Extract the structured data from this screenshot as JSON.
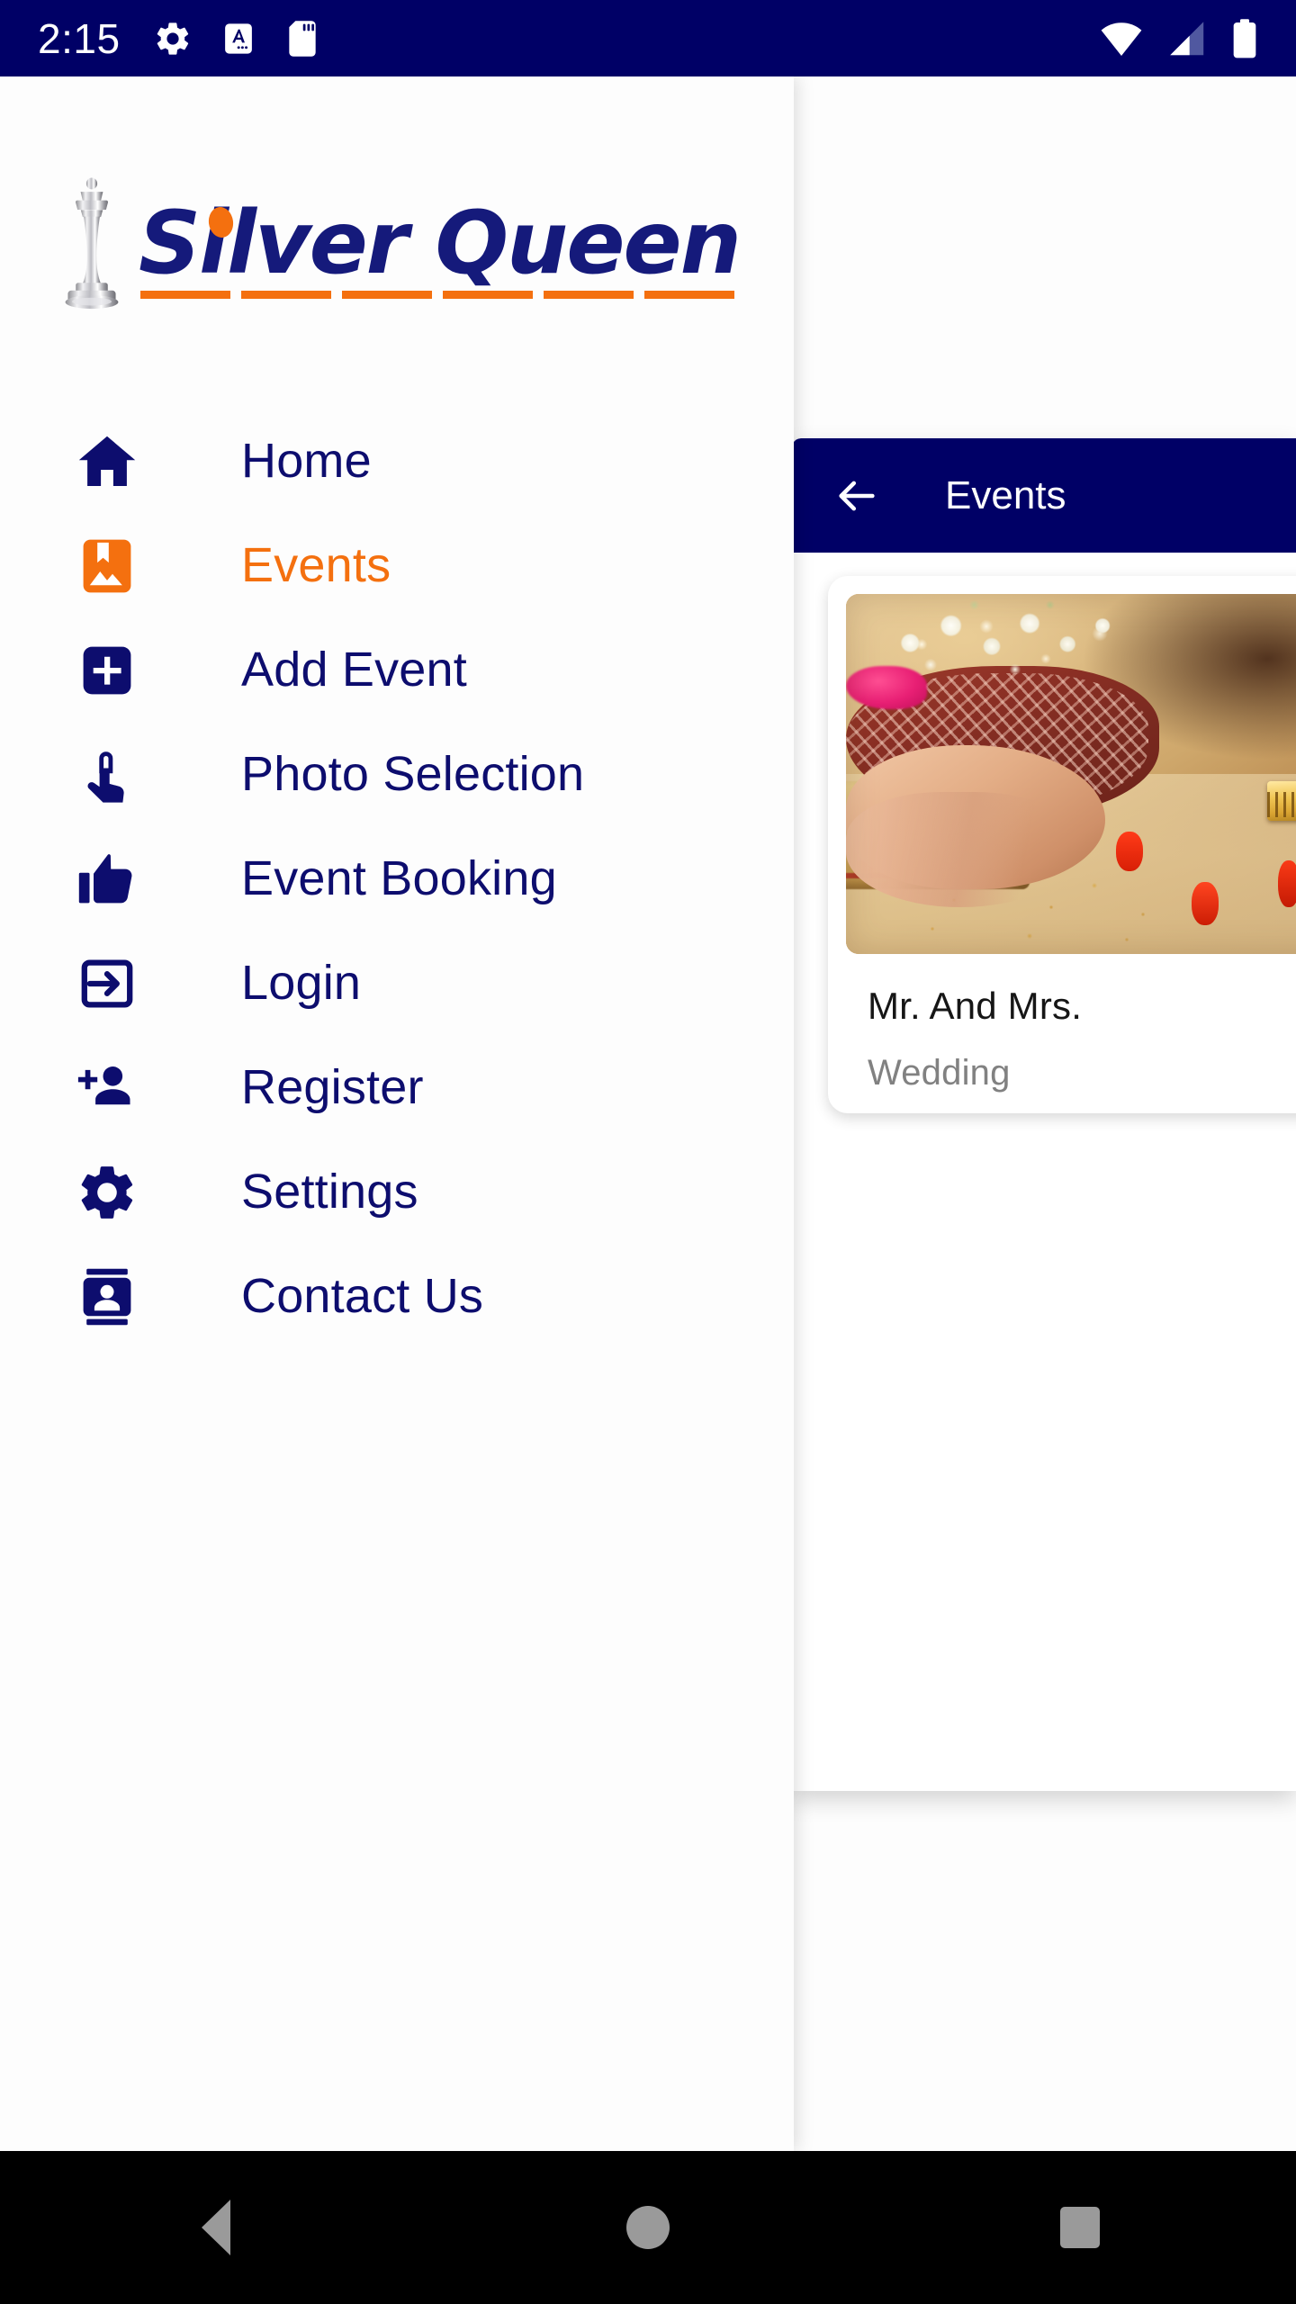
{
  "status_bar": {
    "time": "2:15",
    "left_icons": [
      "gear-icon",
      "font-size-a-icon",
      "sd-card-icon"
    ],
    "right_icons": [
      "wifi-icon",
      "cellular-signal-icon",
      "battery-icon"
    ],
    "background_color": "#000066"
  },
  "brand": {
    "name": "Silver Queen",
    "logo_icon": "chess-queen-icon",
    "text_color": "#151a7b",
    "accent_color": "#f4700f"
  },
  "drawer": {
    "items": [
      {
        "label": "Home",
        "icon": "home-icon",
        "active": false
      },
      {
        "label": "Events",
        "icon": "photo-album-icon",
        "active": true
      },
      {
        "label": "Add Event",
        "icon": "add-box-icon",
        "active": false
      },
      {
        "label": "Photo Selection",
        "icon": "touch-app-icon",
        "active": false
      },
      {
        "label": "Event Booking",
        "icon": "thumb-up-icon",
        "active": false
      },
      {
        "label": "Login",
        "icon": "login-icon",
        "active": false
      },
      {
        "label": "Register",
        "icon": "person-add-icon",
        "active": false
      },
      {
        "label": "Settings",
        "icon": "gear-icon",
        "active": false
      },
      {
        "label": "Contact Us",
        "icon": "contact-page-icon",
        "active": false
      }
    ]
  },
  "content_panel": {
    "app_bar": {
      "back_icon": "arrow-back-icon",
      "title": "Events"
    },
    "events": [
      {
        "title": "Mr. And Mrs.",
        "subtitle": "Wedding",
        "image": "wedding-henna-hands-photo"
      }
    ]
  },
  "system_nav": {
    "back_label": "back-triangle",
    "home_label": "home-circle",
    "recents_label": "recents-square"
  },
  "colors": {
    "navy": "#000066",
    "navy_text": "#0d0d6e",
    "orange": "#f4700f",
    "panel_bg": "#ffffff",
    "card_title": "#161616",
    "card_subtitle": "#818181",
    "system_nav_bg": "#000000"
  }
}
